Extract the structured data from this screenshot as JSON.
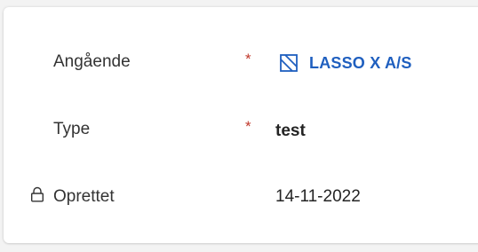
{
  "form": {
    "fields": [
      {
        "label": "Angående",
        "required_mark": "*",
        "value": "LASSO X A/S",
        "value_type": "lookup",
        "value_icon": "entity-record-icon",
        "locked": false
      },
      {
        "label": "Type",
        "required_mark": "*",
        "value": "test",
        "value_type": "text",
        "locked": false
      },
      {
        "label": "Oprettet",
        "required_mark": "",
        "value": "14-11-2022",
        "value_type": "text",
        "locked": true,
        "lock_icon": "lock-icon"
      }
    ]
  },
  "colors": {
    "required": "#c0382b",
    "link": "#1f5fbf",
    "label": "#333333",
    "value": "#242424"
  }
}
